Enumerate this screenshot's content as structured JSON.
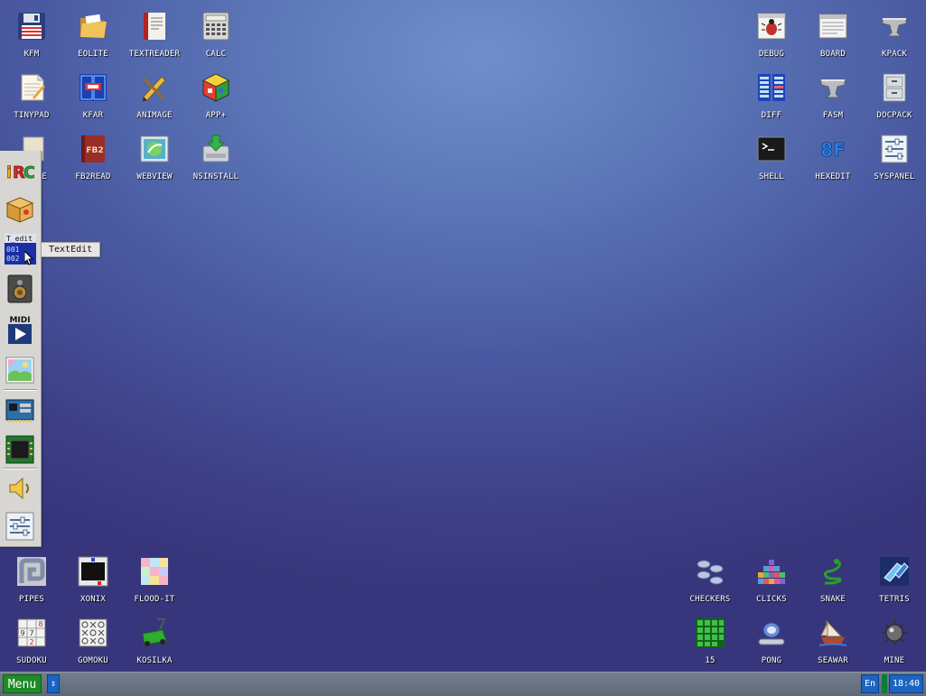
{
  "desktop": {
    "icons_top_left": [
      {
        "label": "KFM",
        "icon": "floppy-icon"
      },
      {
        "label": "EOLITE",
        "icon": "folder-icon"
      },
      {
        "label": "TEXTREADER",
        "icon": "book-icon"
      },
      {
        "label": "CALC",
        "icon": "calculator-icon"
      },
      {
        "label": "TINYPAD",
        "icon": "notepad-icon"
      },
      {
        "label": "KFAR",
        "icon": "kfar-icon"
      },
      {
        "label": "ANIMAGE",
        "icon": "pencil-icon"
      },
      {
        "label": "APP+",
        "icon": "cube-icon"
      },
      {
        "label": "E",
        "icon": "archive-icon"
      },
      {
        "label": "FB2READ",
        "icon": "fb2-book-icon"
      },
      {
        "label": "WEBVIEW",
        "icon": "web-icon"
      },
      {
        "label": "NSINSTALL",
        "icon": "install-icon"
      }
    ],
    "icons_top_right": [
      {
        "label": "DEBUG",
        "icon": "bug-icon"
      },
      {
        "label": "BOARD",
        "icon": "board-window-icon"
      },
      {
        "label": "KPACK",
        "icon": "anvil-icon"
      },
      {
        "label": "DIFF",
        "icon": "diff-icon"
      },
      {
        "label": "FASM",
        "icon": "anvil-icon"
      },
      {
        "label": "DOCPACK",
        "icon": "cabinet-icon"
      },
      {
        "label": "SHELL",
        "icon": "terminal-icon"
      },
      {
        "label": "HEXEDIT",
        "icon": "hex-icon"
      },
      {
        "label": "SYSPANEL",
        "icon": "sliders-icon"
      }
    ],
    "icons_bottom_left": [
      {
        "label": "PIPES",
        "icon": "pipes-icon"
      },
      {
        "label": "XONIX",
        "icon": "xonix-icon"
      },
      {
        "label": "FLOOD-IT",
        "icon": "flood-icon"
      },
      {
        "label": "SUDOKU",
        "icon": "sudoku-icon"
      },
      {
        "label": "GOMOKU",
        "icon": "gomoku-icon"
      },
      {
        "label": "KOSILKA",
        "icon": "lawnmower-icon"
      }
    ],
    "icons_bottom_right": [
      {
        "label": "CHECKERS",
        "icon": "checkers-icon"
      },
      {
        "label": "CLICKS",
        "icon": "clicks-icon"
      },
      {
        "label": "SNAKE",
        "icon": "snake-icon"
      },
      {
        "label": "TETRIS",
        "icon": "tetris-icon"
      },
      {
        "label": "15",
        "icon": "fifteen-icon"
      },
      {
        "label": "PONG",
        "icon": "pong-icon"
      },
      {
        "label": "SEAWAR",
        "icon": "ship-icon"
      },
      {
        "label": "MINE",
        "icon": "mine-icon"
      }
    ]
  },
  "dock": {
    "items": [
      {
        "name": "irc-icon",
        "text": "iRC"
      },
      {
        "name": "package-icon"
      },
      {
        "name": "textedit-icon",
        "text": "T_edit",
        "line1": "001",
        "line2": "002"
      },
      {
        "name": "speaker-icon"
      },
      {
        "name": "midi-icon",
        "text": "MIDI"
      },
      {
        "name": "image-viewer-icon"
      },
      {
        "name": "network-card-icon"
      },
      {
        "name": "cpu-icon"
      },
      {
        "name": "volume-icon"
      },
      {
        "name": "settings-sliders-icon"
      }
    ],
    "tooltip": "TextEdit"
  },
  "taskbar": {
    "menu_label": "Menu",
    "scroll_symbol": "⇕",
    "language": "En",
    "clock": "18:40"
  },
  "colors": {
    "menu_button": "#1f8a28",
    "taskbar_button": "#1b64c0",
    "desktop_top": "#6f8fcb",
    "desktop_bottom": "#37367c"
  }
}
